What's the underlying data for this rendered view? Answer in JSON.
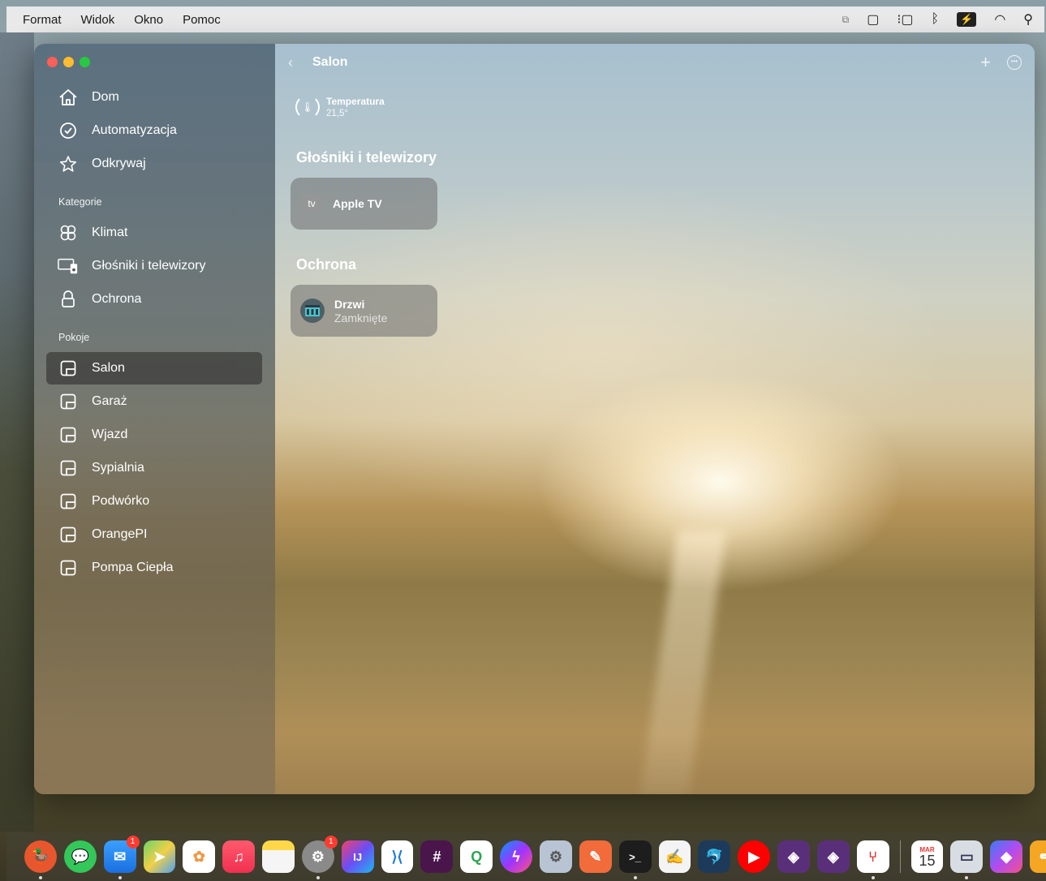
{
  "menubar": {
    "items": [
      "Format",
      "Widok",
      "Okno",
      "Pomoc"
    ],
    "status_icons": [
      "keyboard-icon",
      "screen-mirroring-icon",
      "stage-manager-icon",
      "bluetooth-icon",
      "battery-icon",
      "wifi-icon",
      "spotlight-search-icon"
    ]
  },
  "sidebar": {
    "main_items": [
      {
        "label": "Dom",
        "icon": "house-icon"
      },
      {
        "label": "Automatyzacja",
        "icon": "clock-check-icon"
      },
      {
        "label": "Odkrywaj",
        "icon": "star-icon"
      }
    ],
    "categories_label": "Kategorie",
    "categories": [
      {
        "label": "Klimat",
        "icon": "fan-icon"
      },
      {
        "label": "Głośniki i telewizory",
        "icon": "tv-speaker-icon"
      },
      {
        "label": "Ochrona",
        "icon": "lock-icon"
      }
    ],
    "rooms_label": "Pokoje",
    "rooms": [
      {
        "label": "Salon",
        "selected": true
      },
      {
        "label": "Garaż"
      },
      {
        "label": "Wjazd"
      },
      {
        "label": "Sypialnia"
      },
      {
        "label": "Podwórko"
      },
      {
        "label": "OrangePI"
      },
      {
        "label": "Pompa Ciepła"
      }
    ]
  },
  "header": {
    "title": "Salon"
  },
  "temperature": {
    "label": "Temperatura",
    "value": "21,5°"
  },
  "sections": {
    "speakers_title": "Głośniki i telewizory",
    "security_title": "Ochrona"
  },
  "tiles": {
    "apple_tv": {
      "icon_text": "tv",
      "name": "Apple TV"
    },
    "door": {
      "name": "Drzwi",
      "status": "Zamknięte"
    }
  },
  "dock": {
    "mail_badge": "1",
    "settings_badge": "1",
    "calendar_month": "MAR",
    "calendar_day": "15"
  }
}
